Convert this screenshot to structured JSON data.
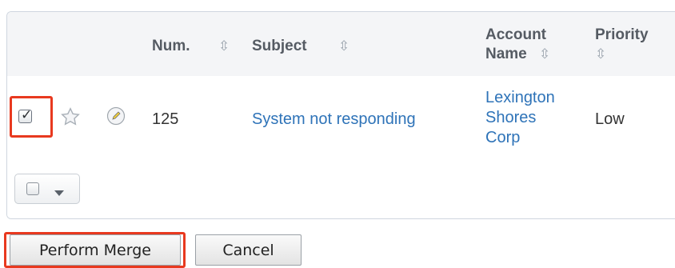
{
  "table": {
    "headers": {
      "num": "Num.",
      "subject": "Subject",
      "account_name_line1": "Account",
      "account_name_line2": "Name",
      "priority": "Priority",
      "sort_glyph": "⇳"
    },
    "rows": [
      {
        "checked": true,
        "num": "125",
        "subject": "System not responding",
        "account_line1": "Lexington",
        "account_line2": "Shores",
        "account_line3": "Corp",
        "priority": "Low"
      }
    ]
  },
  "buttons": {
    "perform_merge": "Perform Merge",
    "cancel": "Cancel"
  },
  "colors": {
    "link": "#2e73b8",
    "highlight": "#e8391f",
    "header_bg": "#f4f5f7"
  },
  "icons": {
    "favorite": "star-icon",
    "edit": "pencil-icon",
    "sort": "sort-icon",
    "dropdown": "caret-down-icon"
  }
}
